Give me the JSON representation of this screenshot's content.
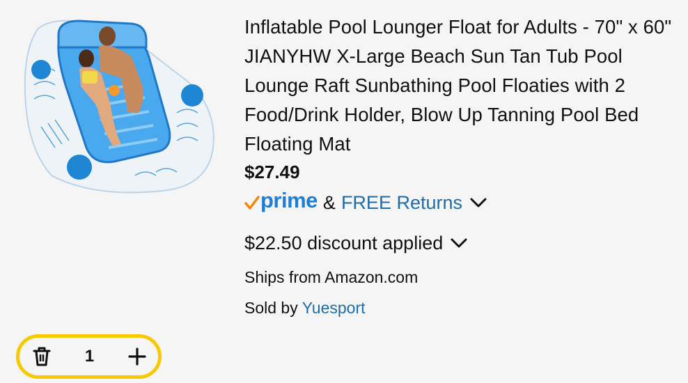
{
  "product": {
    "title": "Inflatable Pool Lounger Float for Adults - 70\" x 60\" JIANYHW X-Large Beach Sun Tan Tub Pool Lounge Raft Sunbathing Pool Floaties with 2 Food/Drink Holder, Blow Up Tanning Pool Bed Floating Mat",
    "price": "$27.49",
    "image_icon": "pool-float-image"
  },
  "prime": {
    "logo_text": "prime",
    "amp": "&",
    "free_returns": "FREE Returns"
  },
  "discount": {
    "text": "$22.50 discount applied"
  },
  "shipping": {
    "ships_from": "Ships from Amazon.com",
    "sold_by_label": "Sold by",
    "seller": "Yuesport"
  },
  "quantity": {
    "value": "1",
    "delete_icon": "trash-icon",
    "increment_icon": "plus-icon"
  },
  "colors": {
    "prime_blue": "#1f7ed2",
    "prime_check": "#f08804",
    "link": "#1f6ca7",
    "stepper_border": "#f7ca00"
  }
}
